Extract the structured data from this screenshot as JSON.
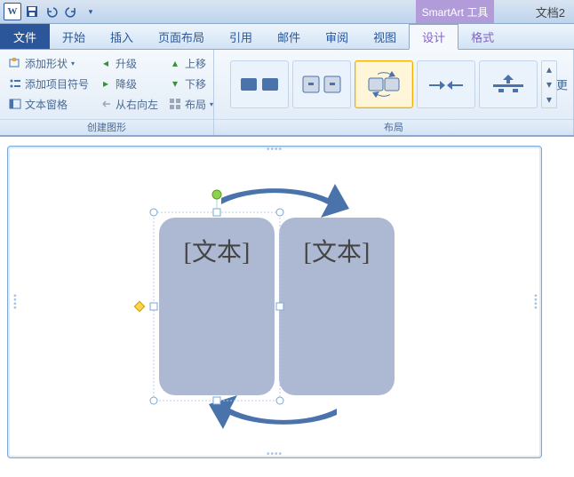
{
  "titlebar": {
    "context_tab": "SmartArt 工具",
    "doc_title": "文档2"
  },
  "menu": {
    "file": "文件",
    "items": [
      "开始",
      "插入",
      "页面布局",
      "引用",
      "邮件",
      "审阅",
      "视图"
    ],
    "context_items": [
      "设计",
      "格式"
    ],
    "active": "设计"
  },
  "ribbon": {
    "group_create": {
      "label": "创建图形",
      "add_shape": "添加形状",
      "add_bullet": "添加项目符号",
      "text_pane": "文本窗格",
      "promote": "升级",
      "demote": "降级",
      "rtl": "从右向左",
      "move_up": "上移",
      "move_down": "下移",
      "layout_btn": "布局"
    },
    "group_layout": {
      "label": "布局"
    },
    "change_more": "更"
  },
  "smartart": {
    "left_text": "[文本]",
    "right_text": "[文本]"
  }
}
